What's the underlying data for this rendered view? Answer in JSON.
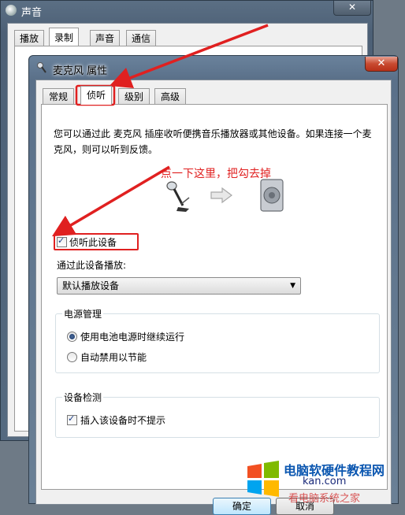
{
  "back_window": {
    "title": "声音",
    "close": "✕",
    "tabs": [
      "播放",
      "录制",
      "声音",
      "通信"
    ],
    "active_tab": "录制"
  },
  "front_window": {
    "title": "麦克风 属性",
    "close": "✕",
    "tabs": [
      "常规",
      "侦听",
      "级别",
      "高级"
    ],
    "active_tab": "侦听",
    "description": "您可以通过此 麦克风 插座收听便携音乐播放器或其他设备。如果连接一个麦克风，则可以听到反馈。",
    "annotation": "点一下这里，把勾去掉",
    "listen_checkbox": {
      "label": "侦听此设备",
      "checked": true
    },
    "playback": {
      "label": "通过此设备播放:",
      "selected": "默认播放设备"
    },
    "power": {
      "title": "电源管理",
      "options": [
        {
          "label": "使用电池电源时继续运行",
          "selected": true
        },
        {
          "label": "自动禁用以节能",
          "selected": false
        }
      ]
    },
    "detection": {
      "title": "设备检测",
      "checkbox": {
        "label": "插入该设备时不提示",
        "checked": true
      }
    },
    "buttons": {
      "ok": "确定",
      "cancel": "取消"
    }
  },
  "watermark": {
    "line1": "电脑软硬件教程网",
    "line2": "kan.com",
    "line3": "看电脑系统之家"
  },
  "colors": {
    "annotation": "#e02020",
    "arrow": "#e02020",
    "accent": "#3c7fb1"
  }
}
